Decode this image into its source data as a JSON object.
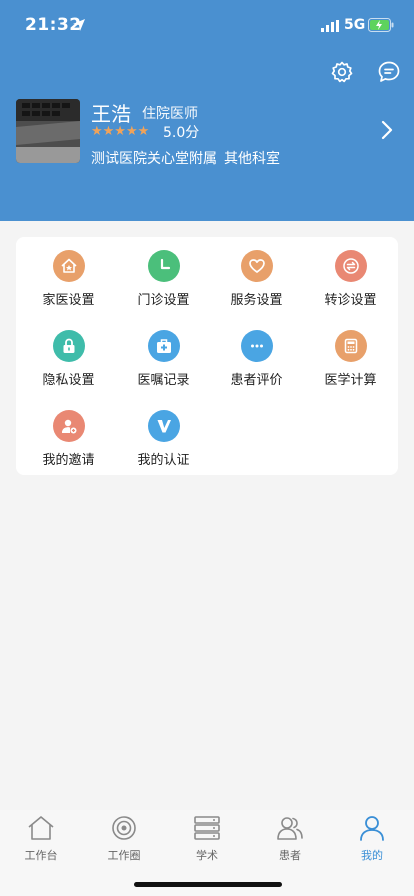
{
  "status": {
    "time": "21:32",
    "network": "5G"
  },
  "profile": {
    "name": "王浩",
    "title": "住院医师",
    "stars": "★★★★★",
    "rating": "5.0分",
    "hospital": "测试医院关心堂附属",
    "department": "其他科室"
  },
  "grid": [
    {
      "label": "家医设置",
      "icon": "home-shield-icon",
      "color": "#e8a06a"
    },
    {
      "label": "门诊设置",
      "icon": "clock-icon",
      "color": "#4bbf7b"
    },
    {
      "label": "服务设置",
      "icon": "heart-icon",
      "color": "#e8a06a"
    },
    {
      "label": "转诊设置",
      "icon": "transfer-icon",
      "color": "#e98873"
    },
    {
      "label": "隐私设置",
      "icon": "lock-icon",
      "color": "#3fbcaa"
    },
    {
      "label": "医嘱记录",
      "icon": "medkit-icon",
      "color": "#4aa5e3"
    },
    {
      "label": "患者评价",
      "icon": "chat-dots-icon",
      "color": "#4aa5e3"
    },
    {
      "label": "医学计算",
      "icon": "calculator-icon",
      "color": "#e8a06a"
    },
    {
      "label": "我的邀请",
      "icon": "invite-user-icon",
      "color": "#e98873"
    },
    {
      "label": "我的认证",
      "icon": "verified-v-icon",
      "color": "#4aa5e3"
    }
  ],
  "tabs": [
    {
      "label": "工作台",
      "icon": "home-icon"
    },
    {
      "label": "工作圈",
      "icon": "target-icon"
    },
    {
      "label": "学术",
      "icon": "server-icon"
    },
    {
      "label": "患者",
      "icon": "users-icon"
    },
    {
      "label": "我的",
      "icon": "user-icon",
      "active": true
    }
  ]
}
